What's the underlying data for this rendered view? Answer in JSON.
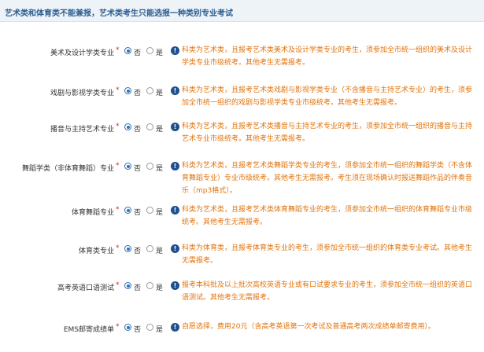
{
  "header": {
    "title": "艺术类和体育类不能兼报，艺术类考生只能选报一种类别专业考试"
  },
  "options": {
    "no": "否",
    "yes": "是"
  },
  "required_mark": "*",
  "info_icon": "!",
  "rows": [
    {
      "label": "美术及设计学类专业",
      "selected": "no",
      "note": "科类为艺术类，且报考艺术类美术及设计学类专业的考生，须参加全市统一组织的美术及设计学类专业市级统考。其他考生无需报考。"
    },
    {
      "label": "戏剧与影视学类专业",
      "selected": "no",
      "note": "科类为艺术类，且报考艺术类戏剧与影视学类专业（不含播音与主持艺术专业）的考生，须参加全市统一组织的戏剧与影视学类专业市级统考。其他考生无需报考。"
    },
    {
      "label": "播音与主持艺术专业",
      "selected": "no",
      "note": "科类为艺术类，且报考艺术类播音与主持艺术专业的考生，须参加全市统一组织的播音与主持艺术专业市级统考。其他考生无需报考。"
    },
    {
      "label": "舞蹈学类（非体育舞蹈）专业",
      "selected": "no",
      "note": "科类为艺术类，且报考艺术类舞蹈学类专业的考生，须参加全市统一组织的舞蹈学类（不含体育舞蹈专业）专业市级统考。其他考生无需报考。考生须在现场确认时报送舞蹈作品的伴奏音乐（mp3格式）。"
    },
    {
      "label": "体育舞蹈专业",
      "selected": "no",
      "note": "科类为艺术类，且报考艺术类体育舞蹈专业的考生，须参加全市统一组织的体育舞蹈专业市级统考。其他考生无需报考。"
    },
    {
      "label": "体育类专业",
      "selected": "no",
      "note": "科类为体育类，且报考体育类专业的考生，须参加全市统一组织的体育类专业考试。其他考生无需报考。"
    },
    {
      "label": "高考英语口语测试",
      "selected": "no",
      "note": "报考本科批及以上批次高校英语专业或有口试要求专业的考生，须参加全市统一组织的英语口语测试。其他考生无需报考。"
    },
    {
      "label": "EMS邮寄成绩单",
      "selected": "no",
      "note": "自愿选择，费用20元（含高考英语第一次考试及普通高考两次成绩单邮寄费用）。"
    }
  ],
  "colors": {
    "note": "#e0740d",
    "required": "#e2231a",
    "radio_selected": "#2f6fb1",
    "info_icon_bg": "#1e4f8e",
    "header_title": "#2a5d8f"
  }
}
